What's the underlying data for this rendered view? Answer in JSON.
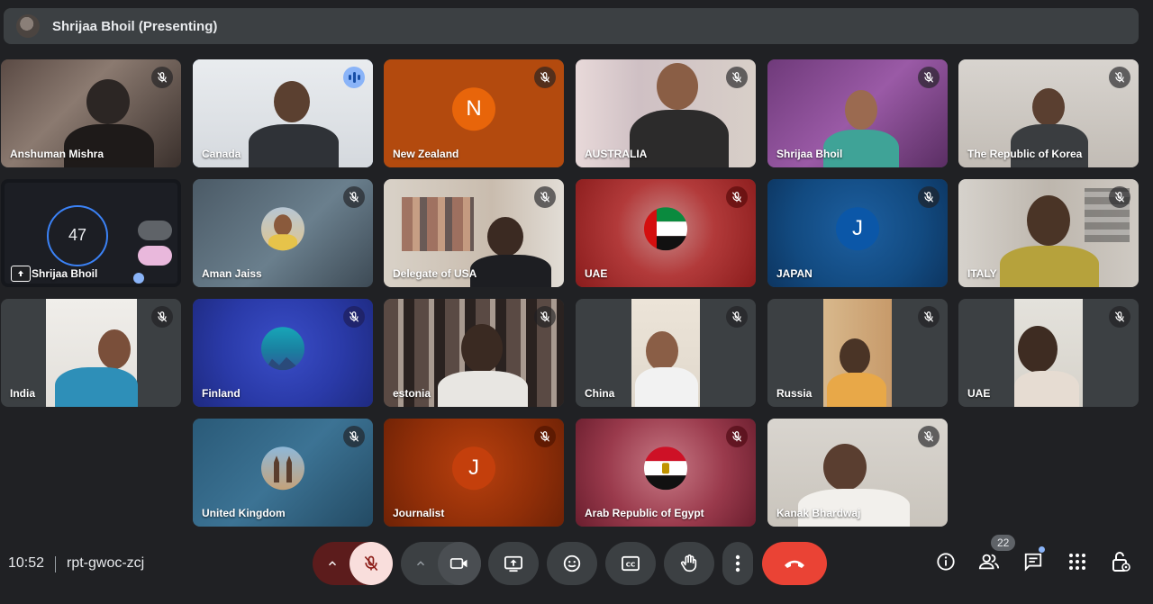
{
  "header": {
    "presenter_title": "Shrijaa Bhoil (Presenting)"
  },
  "tiles": {
    "t0": {
      "name": "Anshuman Mishra"
    },
    "t1": {
      "name": "Canada"
    },
    "t2": {
      "name": "New Zealand",
      "initial": "N"
    },
    "t3": {
      "name": "AUSTRALIA"
    },
    "t4": {
      "name": "Shrijaa Bhoil"
    },
    "t5": {
      "name": "The Republic of Korea"
    },
    "t6": {
      "name": "Shrijaa Bhoil",
      "timer_value": "47"
    },
    "t7": {
      "name": "Aman Jaiss"
    },
    "t8": {
      "name": "Delegate of USA"
    },
    "t9": {
      "name": "UAE"
    },
    "t10": {
      "name": "JAPAN",
      "initial": "J"
    },
    "t11": {
      "name": "ITALY"
    },
    "t12": {
      "name": "India"
    },
    "t13": {
      "name": "Finland"
    },
    "t14": {
      "name": "estonia"
    },
    "t15": {
      "name": "China"
    },
    "t16": {
      "name": "Russia"
    },
    "t17": {
      "name": "UAE"
    },
    "t18": {
      "name": "United Kingdom"
    },
    "t19": {
      "name": "Journalist",
      "initial": "J"
    },
    "t20": {
      "name": "Arab Republic of Egypt"
    },
    "t21": {
      "name": "Kanak Bhardwaj"
    }
  },
  "footer": {
    "time": "10:52",
    "meeting_code": "rpt-gwoc-zcj",
    "participant_count": "22"
  },
  "colors": {
    "background": "#202124",
    "tile": "#3c4043",
    "end_call": "#ea4335",
    "mic_off": "#f9dedc",
    "accent": "#8ab4f8"
  }
}
